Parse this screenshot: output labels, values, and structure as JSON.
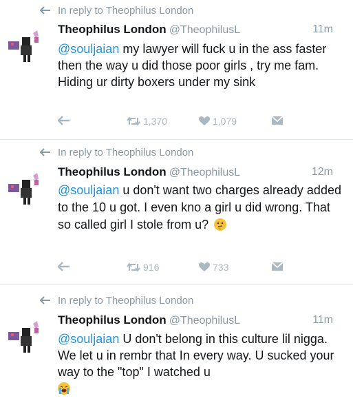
{
  "tweets": [
    {
      "reply_to": "In reply to Theophilus London",
      "name": "Theophilus London",
      "handle": "@TheophilusL",
      "time": "11m",
      "mention": "@souljaian",
      "text": " my lawyer will fuck u in the ass faster then the way u did those poor girls , try me fam. Hiding ur dirty boxers under my sink",
      "emoji": "",
      "retweets": "1,370",
      "likes": "1,079"
    },
    {
      "reply_to": "In reply to Theophilus London",
      "name": "Theophilus London",
      "handle": "@TheophilusL",
      "time": "12m",
      "mention": "@souljaian",
      "text": " u don't want two charges already added to the 10 u got. I even kno a girl u did wrong. That so called girl I stole from u?",
      "emoji": "thinking-face",
      "retweets": "916",
      "likes": "733"
    },
    {
      "reply_to": "In reply to Theophilus London",
      "name": "Theophilus London",
      "handle": "@TheophilusL",
      "time": "11m",
      "mention": "@souljaian",
      "text": " U don't belong in this culture lil nigga. We let u in rembr that In every way. U sucked your way to the \"top\" I watched u",
      "emoji": "loudly-crying-face",
      "retweets": "",
      "likes": ""
    }
  ],
  "colors": {
    "text": "#14171a",
    "muted": "#8899a6",
    "link": "#1b95e0",
    "icon": "#aab8c2",
    "divider": "#e1e8ed"
  }
}
